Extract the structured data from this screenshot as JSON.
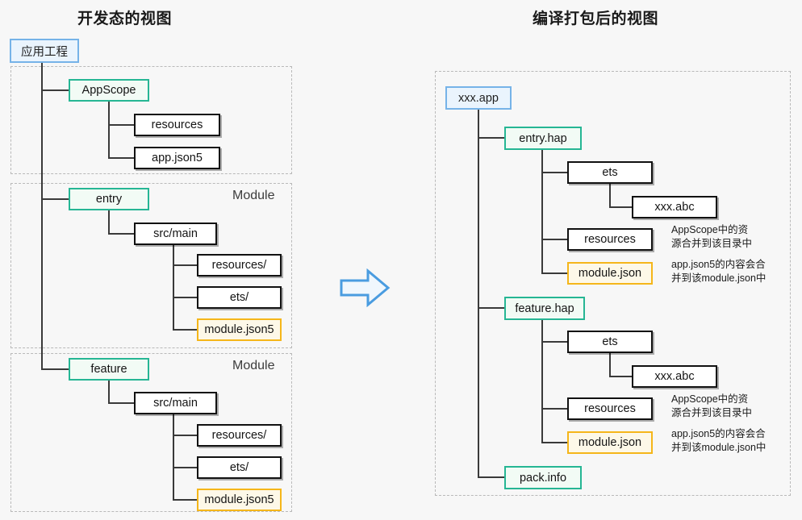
{
  "titles": {
    "left": "开发态的视图",
    "right": "编译打包后的视图"
  },
  "group_labels": {
    "module_entry": "Module",
    "module_feature": "Module"
  },
  "arrow": {
    "name": "right-arrow",
    "color": "#4a9ce0",
    "fill": "#f0f7fd"
  },
  "left_tree": {
    "root": "应用工程",
    "appscope": {
      "label": "AppScope",
      "children": [
        "resources",
        "app.json5"
      ]
    },
    "entry": {
      "label": "entry",
      "src_main": "src/main",
      "children": [
        "resources/",
        "ets/",
        "module.json5"
      ]
    },
    "feature": {
      "label": "feature",
      "src_main": "src/main",
      "children": [
        "resources/",
        "ets/",
        "module.json5"
      ]
    }
  },
  "right_tree": {
    "root": "xxx.app",
    "entry_hap": {
      "label": "entry.hap",
      "ets": "ets",
      "abc": "xxx.abc",
      "resources": "resources",
      "module_json": "module.json"
    },
    "feature_hap": {
      "label": "feature.hap",
      "ets": "ets",
      "abc": "xxx.abc",
      "resources": "resources",
      "module_json": "module.json"
    },
    "pack_info": "pack.info"
  },
  "annotations": {
    "entry_resources": "AppScope中的资\n源合并到该目录中",
    "entry_module": "app.json5的内容会合\n并到该module.json中",
    "feature_resources": "AppScope中的资\n源合并到该目录中",
    "feature_module": "app.json5的内容会合\n并到该module.json中"
  },
  "colors": {
    "background": "#f7f7f7",
    "blue_border": "#76b3e8",
    "green_border": "#26b694",
    "yellow_border": "#f5b61a",
    "black_border": "#111111",
    "dashed": "#b9b9b9"
  }
}
